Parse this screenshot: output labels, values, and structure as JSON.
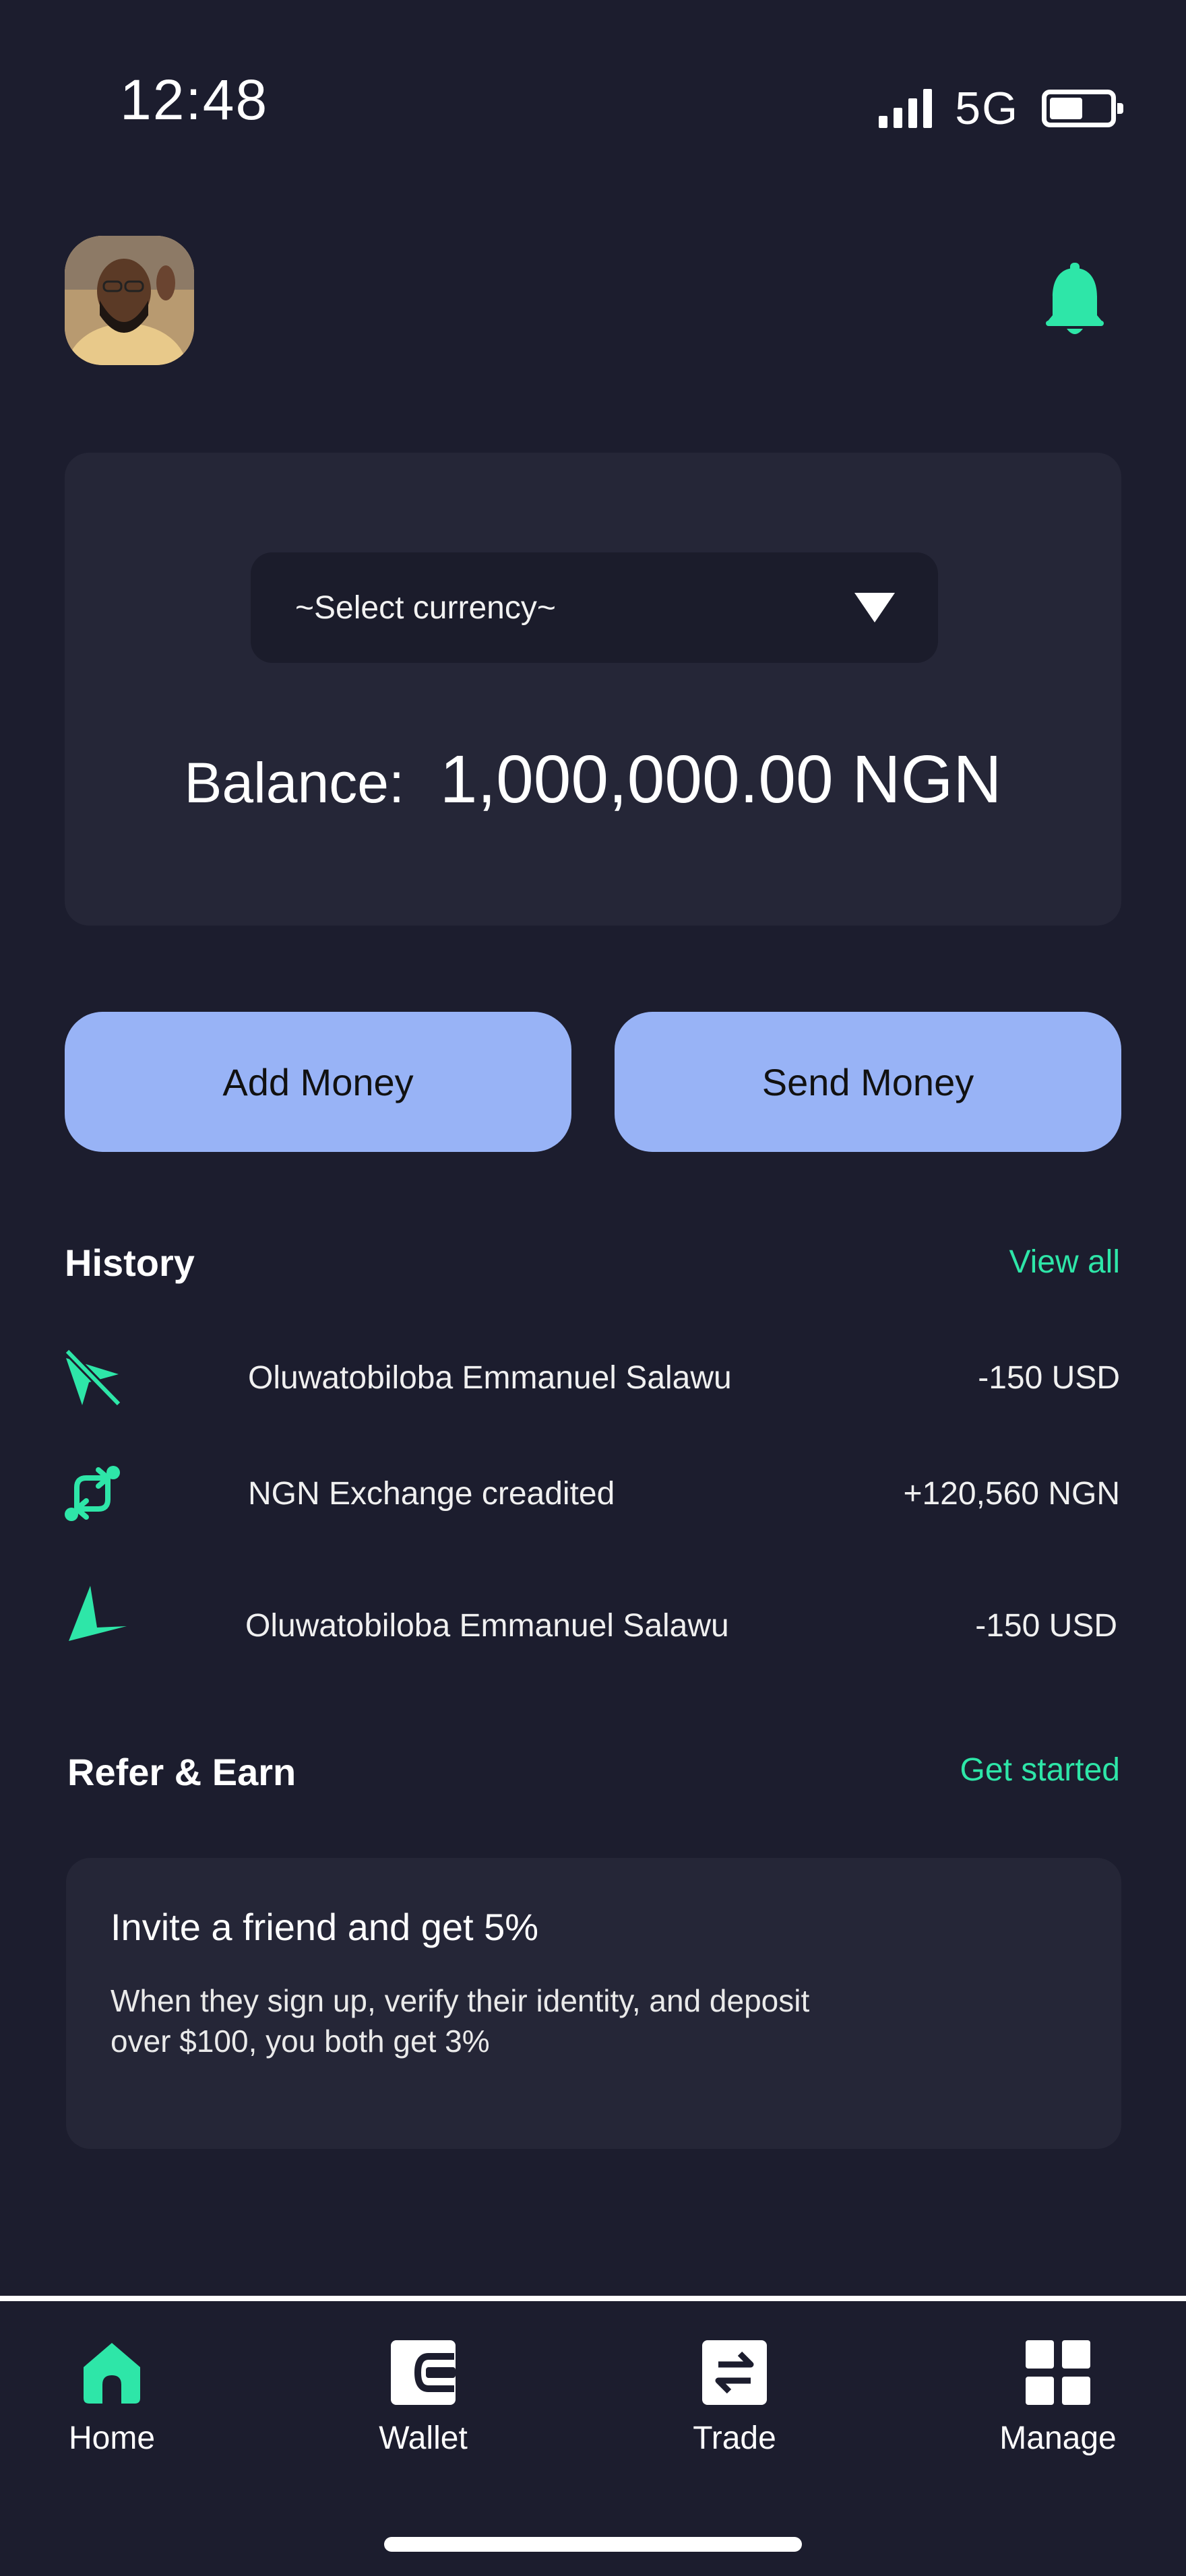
{
  "status_bar": {
    "time": "12:48",
    "network": "5G"
  },
  "header": {
    "avatar": "user-avatar",
    "notification_icon": "bell-icon"
  },
  "balance_card": {
    "currency_placeholder": "~Select currency~",
    "balance_label": "Balance:",
    "balance_amount": "1,000,000.00 NGN"
  },
  "actions": {
    "add_money": "Add Money",
    "send_money": "Send Money"
  },
  "history": {
    "title": "History",
    "view_all": "View all",
    "items": [
      {
        "icon": "send-cancelled-icon",
        "name": "Oluwatobiloba Emmanuel Salawu",
        "amount": "-150 USD"
      },
      {
        "icon": "exchange-icon",
        "name": "NGN Exchange creadited",
        "amount": "+120,560 NGN"
      },
      {
        "icon": "send-icon",
        "name": "Oluwatobiloba Emmanuel Salawu",
        "amount": "-150 USD"
      }
    ]
  },
  "refer": {
    "title": "Refer & Earn",
    "link": "Get started",
    "card_title": "Invite a friend and get 5%",
    "card_body": "When they sign up, verify their identity, and deposit over $100, you both get 3%"
  },
  "nav": {
    "items": [
      {
        "label": "Home",
        "icon": "home-icon"
      },
      {
        "label": "Wallet",
        "icon": "wallet-icon"
      },
      {
        "label": "Trade",
        "icon": "trade-icon"
      },
      {
        "label": "Manage",
        "icon": "grid-icon"
      }
    ]
  },
  "colors": {
    "accent": "#2ee6a8",
    "button": "#98b3f6",
    "background": "#1c1d2e",
    "card": "#252637"
  }
}
